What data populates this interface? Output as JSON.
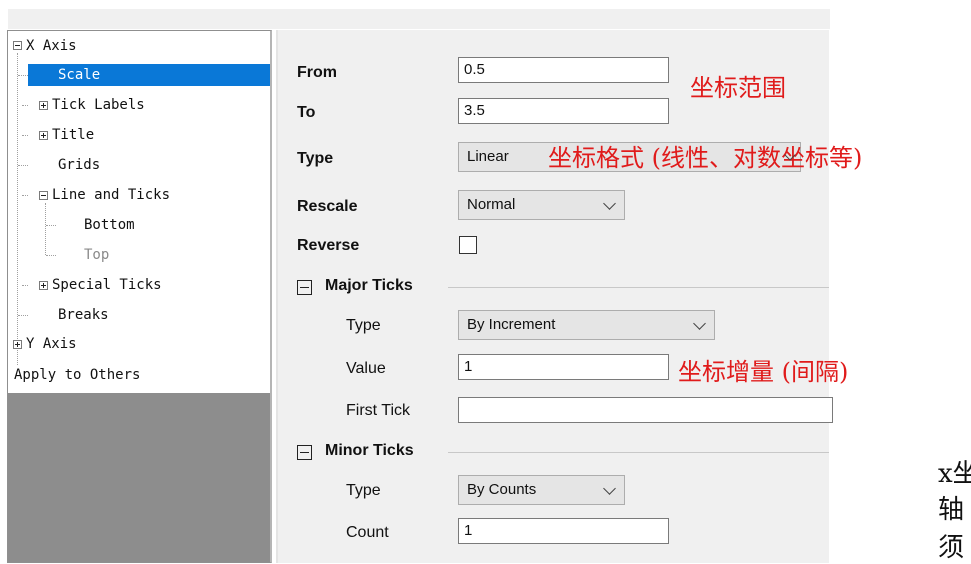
{
  "tree": {
    "items": [
      {
        "label": "X Axis",
        "expander": "minus"
      },
      {
        "label": "Scale",
        "selected": true
      },
      {
        "label": "Tick Labels",
        "expander": "plus"
      },
      {
        "label": "Title",
        "expander": "plus"
      },
      {
        "label": "Grids"
      },
      {
        "label": "Line and Ticks",
        "expander": "minus"
      },
      {
        "label": "Bottom"
      },
      {
        "label": "Top",
        "disabled": true
      },
      {
        "label": "Special Ticks",
        "expander": "plus"
      },
      {
        "label": "Breaks"
      },
      {
        "label": "Y Axis",
        "expander": "plus"
      },
      {
        "label": "Apply to Others"
      }
    ]
  },
  "scale": {
    "from_label": "From",
    "from_value": "0.5",
    "to_label": "To",
    "to_value": "3.5",
    "type_label": "Type",
    "type_value": "Linear",
    "rescale_label": "Rescale",
    "rescale_value": "Normal",
    "reverse_label": "Reverse",
    "reverse_checked": false
  },
  "major_ticks": {
    "section_label": "Major Ticks",
    "type_label": "Type",
    "type_value": "By Increment",
    "value_label": "Value",
    "value_value": "1",
    "first_tick_label": "First Tick",
    "first_tick_value": ""
  },
  "minor_ticks": {
    "section_label": "Minor Ticks",
    "type_label": "Type",
    "type_value": "By Counts",
    "count_label": "Count",
    "count_value": "1"
  },
  "annotations": {
    "range": "坐标范围",
    "format": "坐标格式 (线性、对数坐标等)",
    "increment": "坐标增量 (间隔)",
    "color": "#e01b1b"
  },
  "side_text": {
    "line1": "x坐",
    "line2": "轴",
    "line3": "须"
  },
  "colors": {
    "selection": "#0a78d7",
    "panel_bg": "#f0f0f0",
    "tree_empty_bg": "#8d8d8d"
  }
}
